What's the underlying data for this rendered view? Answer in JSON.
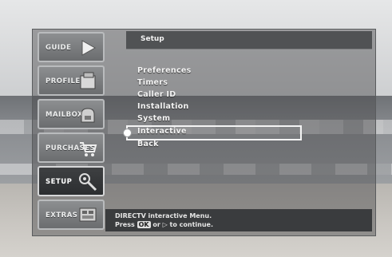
{
  "sidebar": {
    "tabs": [
      {
        "label": "GUIDE",
        "icon": "arrow-right-icon",
        "active": false
      },
      {
        "label": "PROFILES",
        "icon": "profile-card-icon",
        "active": false
      },
      {
        "label": "MAILBOX",
        "icon": "mailbox-icon",
        "active": false
      },
      {
        "label": "PURCHASES",
        "icon": "shopping-cart-icon",
        "active": false
      },
      {
        "label": "SETUP",
        "icon": "tools-icon",
        "active": true
      },
      {
        "label": "EXTRAS",
        "icon": "extras-icon",
        "active": false
      }
    ]
  },
  "header": {
    "title": "Setup"
  },
  "menu": {
    "items": [
      {
        "label": "Preferences",
        "selected": false
      },
      {
        "label": "Timers",
        "selected": false
      },
      {
        "label": "Caller ID",
        "selected": false
      },
      {
        "label": "Installation",
        "selected": false
      },
      {
        "label": "System",
        "selected": false
      },
      {
        "label": "Interactive",
        "selected": true
      },
      {
        "label": "Back",
        "selected": false
      }
    ]
  },
  "help": {
    "line1": "DIRECTV interactive Menu.",
    "line2_prefix": "Press",
    "ok_key": "OK",
    "line2_suffix": "or ▷ to continue."
  },
  "colors": {
    "selection_border": "#f4f4f4",
    "active_tab": "#2c2e30"
  }
}
